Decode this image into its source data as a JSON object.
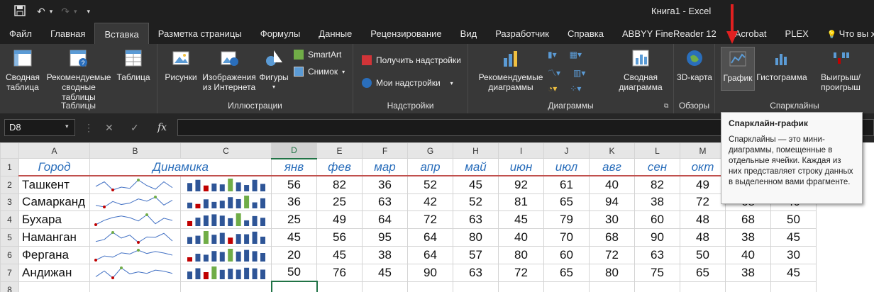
{
  "titlebar": {
    "title": "Книга1  -  Excel",
    "save_icon": "save-icon",
    "undo_icon": "undo-icon",
    "redo_icon": "redo-icon"
  },
  "tabs": [
    "Файл",
    "Главная",
    "Вставка",
    "Разметка страницы",
    "Формулы",
    "Данные",
    "Рецензирование",
    "Вид",
    "Разработчик",
    "Справка",
    "ABBYY FineReader 12",
    "Acrobat",
    "PLEX",
    "Что вы хотите сдела"
  ],
  "active_tab": "Вставка",
  "ribbon": {
    "tables": {
      "label": "Таблицы",
      "pivot": "Сводная таблица",
      "rec_pivot": "Рекомендуемые сводные таблицы",
      "table": "Таблица"
    },
    "illustrations": {
      "label": "Иллюстрации",
      "pictures": "Рисунки",
      "online": "Изображения из Интернета",
      "shapes": "Фигуры",
      "smartart": "SmartArt",
      "screenshot": "Снимок"
    },
    "addins": {
      "label": "Надстройки",
      "get": "Получить надстройки",
      "my": "Мои надстройки"
    },
    "charts": {
      "label": "Диаграммы",
      "rec": "Рекомендуемые диаграммы",
      "pivot": "Сводная диаграмма"
    },
    "tours": {
      "label": "Обзоры",
      "map3d": "3D-карта"
    },
    "sparklines": {
      "label": "Спарклайны",
      "line": "График",
      "column": "Гистограмма",
      "winloss": "Выигрыш/ проигрыш"
    }
  },
  "formula_bar": {
    "name_box": "D8",
    "fx": "fx"
  },
  "tooltip": {
    "title": "Спарклайн-график",
    "body": "Спарклайны — это мини-диаграммы, помещенные в отдельные ячейки. Каждая из них представляет строку данных в выделенном вами фрагменте."
  },
  "columns": [
    "A",
    "B",
    "C",
    "D",
    "E",
    "F",
    "G",
    "H",
    "I",
    "J",
    "K",
    "L",
    "M",
    "N",
    "O"
  ],
  "header_row": {
    "city": "Город",
    "dynamics": "Динамика",
    "months": [
      "янв",
      "фев",
      "мар",
      "апр",
      "май",
      "июн",
      "июл",
      "авг",
      "сен",
      "окт"
    ]
  },
  "rows": [
    {
      "num": "2",
      "city": "Ташкент",
      "values": [
        "56",
        "82",
        "36",
        "52",
        "45",
        "92",
        "61",
        "40",
        "82",
        "49"
      ],
      "extra": [
        "",
        ""
      ]
    },
    {
      "num": "3",
      "city": "Самарканд",
      "values": [
        "36",
        "25",
        "63",
        "42",
        "52",
        "81",
        "65",
        "94",
        "38",
        "72"
      ],
      "extra": [
        "68",
        "40"
      ]
    },
    {
      "num": "4",
      "city": "Бухара",
      "values": [
        "25",
        "49",
        "64",
        "72",
        "63",
        "45",
        "79",
        "30",
        "60",
        "48"
      ],
      "extra": [
        "68",
        "50"
      ]
    },
    {
      "num": "5",
      "city": "Наманган",
      "values": [
        "45",
        "56",
        "95",
        "64",
        "80",
        "40",
        "70",
        "68",
        "90",
        "48"
      ],
      "extra": [
        "38",
        "45"
      ]
    },
    {
      "num": "6",
      "city": "Фергана",
      "values": [
        "20",
        "45",
        "38",
        "64",
        "57",
        "80",
        "60",
        "72",
        "63",
        "50"
      ],
      "extra": [
        "40",
        "30"
      ]
    },
    {
      "num": "7",
      "city": "Андижан",
      "values": [
        "50",
        "76",
        "45",
        "90",
        "63",
        "72",
        "65",
        "80",
        "75",
        "65"
      ],
      "extra": [
        "38",
        "45"
      ]
    }
  ],
  "row_numbers": [
    "1",
    "2",
    "3",
    "4",
    "5",
    "6",
    "7",
    "8"
  ],
  "colors": {
    "accent": "#217346",
    "header_text": "#2a6ebb",
    "arrow": "#e02020",
    "spark_line": "#4472c4",
    "spark_col": "#2e5597",
    "spark_high": "#70ad47",
    "spark_low": "#c00000"
  }
}
